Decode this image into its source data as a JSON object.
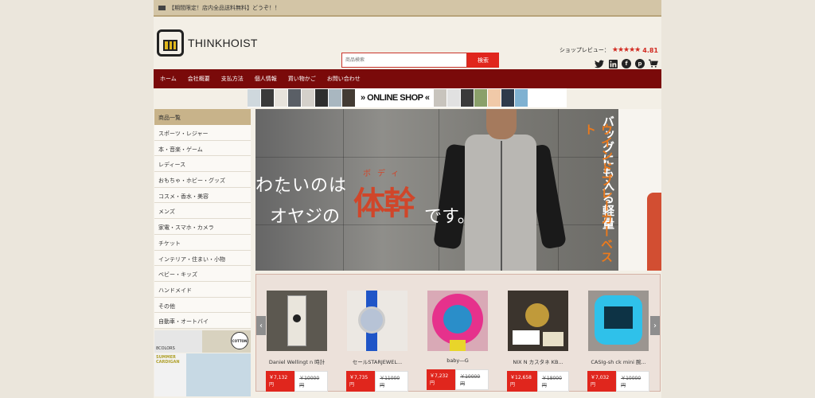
{
  "notice": {
    "text": "【期間限定！店内全品送料無料】どうぞ！！"
  },
  "logo": {
    "name": "THINKHOIST"
  },
  "search": {
    "placeholder": "商品検索",
    "button": "検索"
  },
  "review": {
    "label": "ショップレビュー：",
    "stars": "★★★★★",
    "score": "4.81"
  },
  "social": {
    "twitter": "t",
    "linkedin": "in",
    "facebook": "f",
    "pinterest": "p",
    "cart": "cart"
  },
  "nav": {
    "items": [
      "ホーム",
      "会社概要",
      "支払方法",
      "個人情報",
      "買い物かご",
      "お問い合わせ"
    ]
  },
  "strip": {
    "label": "» ONLINE SHOP «"
  },
  "sidebar": {
    "header": "商品一覧",
    "items": [
      "スポーツ・レジャー",
      "本・音楽・ゲーム",
      "レディース",
      "おもちゃ・ホビー・グッズ",
      "コスメ・香水・美容",
      "メンズ",
      "家電・スマホ・カメラ",
      "チケット",
      "インテリア・住まい・小物",
      "ベビー・キッズ",
      "ハンドメイド",
      "その他",
      "自動車・オートバイ"
    ],
    "banner_colors": "8COLORS",
    "banner_badge": "COTTON 100%",
    "banner_summer": "SUMMER CARDIGAN"
  },
  "hero": {
    "line1": "わたいのは",
    "line2": "オヤジの",
    "big": "体幹",
    "ruby": "ボディ",
    "line3": "です。",
    "vertical1": "バッグにも入る軽量",
    "vertical2": "ウインドブレーカーベスト"
  },
  "products": [
    {
      "name": "Daniel Wellingt n 時計",
      "price": "￥7,132円",
      "was": "￥10000円"
    },
    {
      "name": "セールSTARJEWEL...",
      "price": "￥7,735円",
      "was": "￥11000円"
    },
    {
      "name": "baby―G",
      "price": "￥7,232円",
      "was": "￥10000円"
    },
    {
      "name": "NIX N カスタネ KB...",
      "price": "￥12,658円",
      "was": "￥18000円"
    },
    {
      "name": "CASIg-sh ck mini 腕...",
      "price": "￥7,032円",
      "was": "￥10000円"
    }
  ],
  "colors": {
    "accent": "#e0261d",
    "nav": "#7a0a0a",
    "sidebar_head": "#c8b38a"
  }
}
